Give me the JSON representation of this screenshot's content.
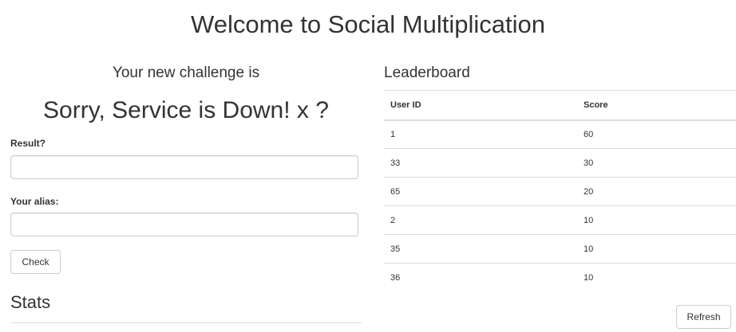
{
  "page": {
    "title": "Welcome to Social Multiplication"
  },
  "challenge": {
    "intro": "Your new challenge is",
    "text": "Sorry, Service is Down! x ?"
  },
  "form": {
    "result_label": "Result?",
    "result_value": "",
    "alias_label": "Your alias:",
    "alias_value": "",
    "check_label": "Check"
  },
  "stats": {
    "heading": "Stats"
  },
  "leaderboard": {
    "heading": "Leaderboard",
    "columns": [
      "User ID",
      "Score"
    ],
    "rows": [
      {
        "user_id": "1",
        "score": "60"
      },
      {
        "user_id": "33",
        "score": "30"
      },
      {
        "user_id": "65",
        "score": "20"
      },
      {
        "user_id": "2",
        "score": "10"
      },
      {
        "user_id": "35",
        "score": "10"
      },
      {
        "user_id": "36",
        "score": "10"
      }
    ],
    "refresh_label": "Refresh"
  }
}
